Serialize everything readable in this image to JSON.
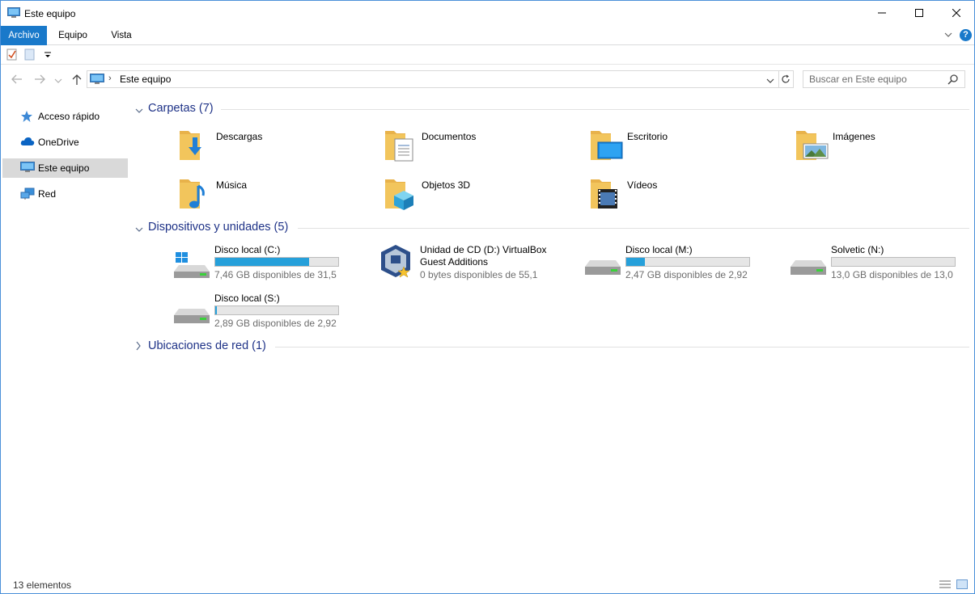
{
  "window": {
    "title": "Este equipo"
  },
  "ribbon": {
    "tabs": [
      "Archivo",
      "Equipo",
      "Vista"
    ],
    "help": "?"
  },
  "address": {
    "path": "Este equipo",
    "separator": "›"
  },
  "search": {
    "placeholder": "Buscar en Este equipo"
  },
  "sidebar": {
    "items": [
      {
        "label": "Acceso rápido",
        "icon": "star-icon"
      },
      {
        "label": "OneDrive",
        "icon": "cloud-icon"
      },
      {
        "label": "Este equipo",
        "icon": "computer-icon",
        "selected": true
      },
      {
        "label": "Red",
        "icon": "network-icon"
      }
    ]
  },
  "groups": {
    "folders": {
      "label": "Carpetas (7)",
      "items": [
        {
          "name": "Descargas",
          "icon": "downloads-folder-icon"
        },
        {
          "name": "Documentos",
          "icon": "documents-folder-icon"
        },
        {
          "name": "Escritorio",
          "icon": "desktop-folder-icon"
        },
        {
          "name": "Imágenes",
          "icon": "pictures-folder-icon"
        },
        {
          "name": "Música",
          "icon": "music-folder-icon"
        },
        {
          "name": "Objetos 3D",
          "icon": "3d-objects-folder-icon"
        },
        {
          "name": "Vídeos",
          "icon": "videos-folder-icon"
        }
      ]
    },
    "devices": {
      "label": "Dispositivos y unidades (5)",
      "items": [
        {
          "name": "Disco local (C:)",
          "free": "7,46 GB disponibles de 31,5",
          "used_fraction": 0.76,
          "icon": "windows-drive-icon"
        },
        {
          "name": "Unidad de CD (D:) VirtualBox",
          "name2": "Guest Additions",
          "free": "0 bytes disponibles de 55,1",
          "icon": "virtualbox-cd-icon"
        },
        {
          "name": "Disco local (M:)",
          "free": "2,47 GB disponibles de 2,92",
          "used_fraction": 0.15,
          "icon": "hard-drive-icon"
        },
        {
          "name": "Solvetic (N:)",
          "free": "13,0 GB disponibles de 13,0",
          "used_fraction": 0.0,
          "icon": "hard-drive-icon"
        },
        {
          "name": "Disco local (S:)",
          "free": "2,89 GB disponibles de 2,92",
          "used_fraction": 0.01,
          "icon": "hard-drive-icon"
        }
      ]
    },
    "network": {
      "label": "Ubicaciones de red (1)"
    }
  },
  "status": {
    "count": "13 elementos"
  },
  "colors": {
    "accent": "#1979ca",
    "bar_fill": "#26a0da",
    "group_header": "#1e3287",
    "folder": "#f2c55c"
  }
}
